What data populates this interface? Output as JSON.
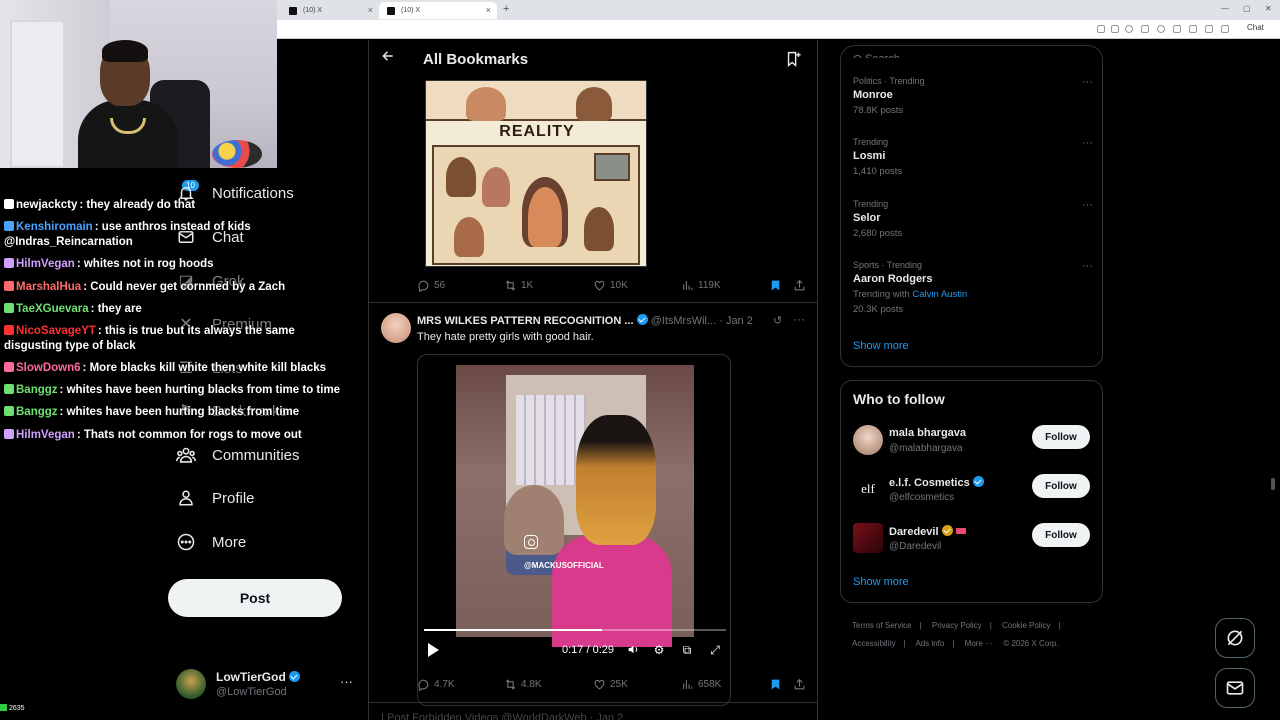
{
  "browser": {
    "tabs": [
      {
        "title": "(10) X",
        "active": false
      },
      {
        "title": "(10) X",
        "active": true
      }
    ],
    "chat_btn": "Chat"
  },
  "stream_chat": {
    "messages": [
      {
        "user": "newjackcty",
        "color": "#ffffff",
        "text": "they already do that"
      },
      {
        "user": "Kenshiromain",
        "color": "#4aa3ff",
        "text": "use anthros instead of kids @Indras_Reincarnation"
      },
      {
        "user": "HilmVegan",
        "color": "#d0a0ff",
        "text": "whites not in rog hoods"
      },
      {
        "user": "MarshalHua",
        "color": "#ff6b6b",
        "text": "Could never get cornmed by a Zach"
      },
      {
        "user": "TaeXGuevara",
        "color": "#6ee06e",
        "text": "they are"
      },
      {
        "user": "NicoSavageYT",
        "color": "#ff3030",
        "text": "this is true but its always the same disgusting type of black"
      },
      {
        "user": "SlowDown6",
        "color": "#ff6b9a",
        "text": "More blacks kill white then white kill blacks"
      },
      {
        "user": "Banggz",
        "color": "#6ee06e",
        "text": "whites have been hurting blacks from time to time"
      },
      {
        "user": "Banggz",
        "color": "#6ee06e",
        "text": "whites have been hurting blacks from time"
      },
      {
        "user": "HilmVegan",
        "color": "#d0a0ff",
        "text": "Thats not common for rogs to move out"
      }
    ],
    "viewer_count": "2635"
  },
  "nav": {
    "notifications_badge": "10",
    "items": [
      "Notifications",
      "Chat",
      "Grok",
      "Premium",
      "Lists",
      "Bookmarks",
      "Communities",
      "Profile",
      "More"
    ],
    "post_label": "Post",
    "account": {
      "name": "LowTierGod",
      "handle": "@LowTierGod"
    }
  },
  "header": {
    "title": "All Bookmarks"
  },
  "meme": {
    "label": "REALITY"
  },
  "tweet1": {
    "replies": "56",
    "reposts": "1K",
    "likes": "10K",
    "views": "119K"
  },
  "tweet2": {
    "name": "MRS WILKES PATTERN RECOGNITION ...",
    "handle": "@ItsMrsWil...",
    "date": "· Jan 2",
    "text": "They hate pretty girls with good hair.",
    "video": {
      "watermark": "@MACKUSOFFICIAL",
      "time": "0:17 / 0:29",
      "progress": 0.59
    },
    "replies": "4.7K",
    "reposts": "4.8K",
    "likes": "25K",
    "views": "658K"
  },
  "next_tweet": {
    "text": "I Post Forbidden Videos  @WorldDarkWeb · Jan 2"
  },
  "search": {
    "placeholder": "Search"
  },
  "trends": [
    {
      "context": "Politics · Trending",
      "title": "Monroe",
      "count": "78.8K posts"
    },
    {
      "context": "Trending",
      "title": "Losmi",
      "count": "1,410 posts"
    },
    {
      "context": "Trending",
      "title": "Selor",
      "count": "2,680 posts"
    },
    {
      "context": "Sports · Trending",
      "title": "Aaron Rodgers",
      "with_prefix": "Trending with",
      "with": "Calvin Austin",
      "count": "20.3K posts"
    }
  ],
  "trends_show_more": "Show more",
  "who_to_follow": {
    "title": "Who to follow",
    "accounts": [
      {
        "name": "mala bhargava",
        "handle": "@malabhargava"
      },
      {
        "name": "e.l.f. Cosmetics",
        "handle": "@elfcosmetics"
      },
      {
        "name": "Daredevil",
        "handle": "@Daredevil"
      }
    ],
    "follow_label": "Follow",
    "show_more": "Show more",
    "elf_logo": "elf"
  },
  "footer": [
    "Terms of Service",
    "|",
    "Privacy Policy",
    "|",
    "Cookie Policy",
    "|",
    "Accessibility",
    "|",
    "Ads info",
    "|",
    "More ···",
    "© 2026 X Corp."
  ],
  "colors": {
    "accent": "#1d9bf0",
    "bg": "#000000",
    "border": "#2f3336",
    "muted": "#71767b"
  }
}
